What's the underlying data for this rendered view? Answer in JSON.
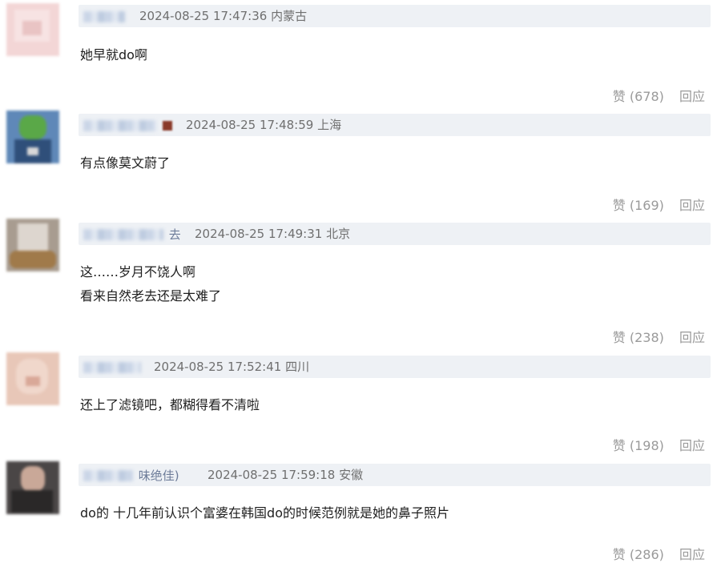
{
  "comments": [
    {
      "username_suffix": "",
      "timestamp": "2024-08-25 17:47:36",
      "location": "内蒙古",
      "lines": [
        "她早就do啊"
      ],
      "like_label": "赞",
      "like_count": "(678)",
      "reply_label": "回应"
    },
    {
      "username_suffix": "",
      "timestamp": "2024-08-25 17:48:59",
      "location": "上海",
      "lines": [
        "有点像莫文蔚了"
      ],
      "like_label": "赞",
      "like_count": "(169)",
      "reply_label": "回应"
    },
    {
      "username_suffix": "去",
      "timestamp": "2024-08-25 17:49:31",
      "location": "北京",
      "lines": [
        "这……岁月不饶人啊",
        "看来自然老去还是太难了"
      ],
      "like_label": "赞",
      "like_count": "(238)",
      "reply_label": "回应"
    },
    {
      "username_suffix": "",
      "timestamp": "2024-08-25 17:52:41",
      "location": "四川",
      "lines": [
        "还上了滤镜吧，都糊得看不清啦"
      ],
      "like_label": "赞",
      "like_count": "(198)",
      "reply_label": "回应"
    },
    {
      "username_suffix": "味绝佳)",
      "timestamp": "2024-08-25 17:59:18",
      "location": "安徽",
      "lines": [
        "do的 十几年前认识个富婆在韩国do的时候范例就是她的鼻子照片"
      ],
      "like_label": "赞",
      "like_count": "(286)",
      "reply_label": "回应"
    }
  ]
}
